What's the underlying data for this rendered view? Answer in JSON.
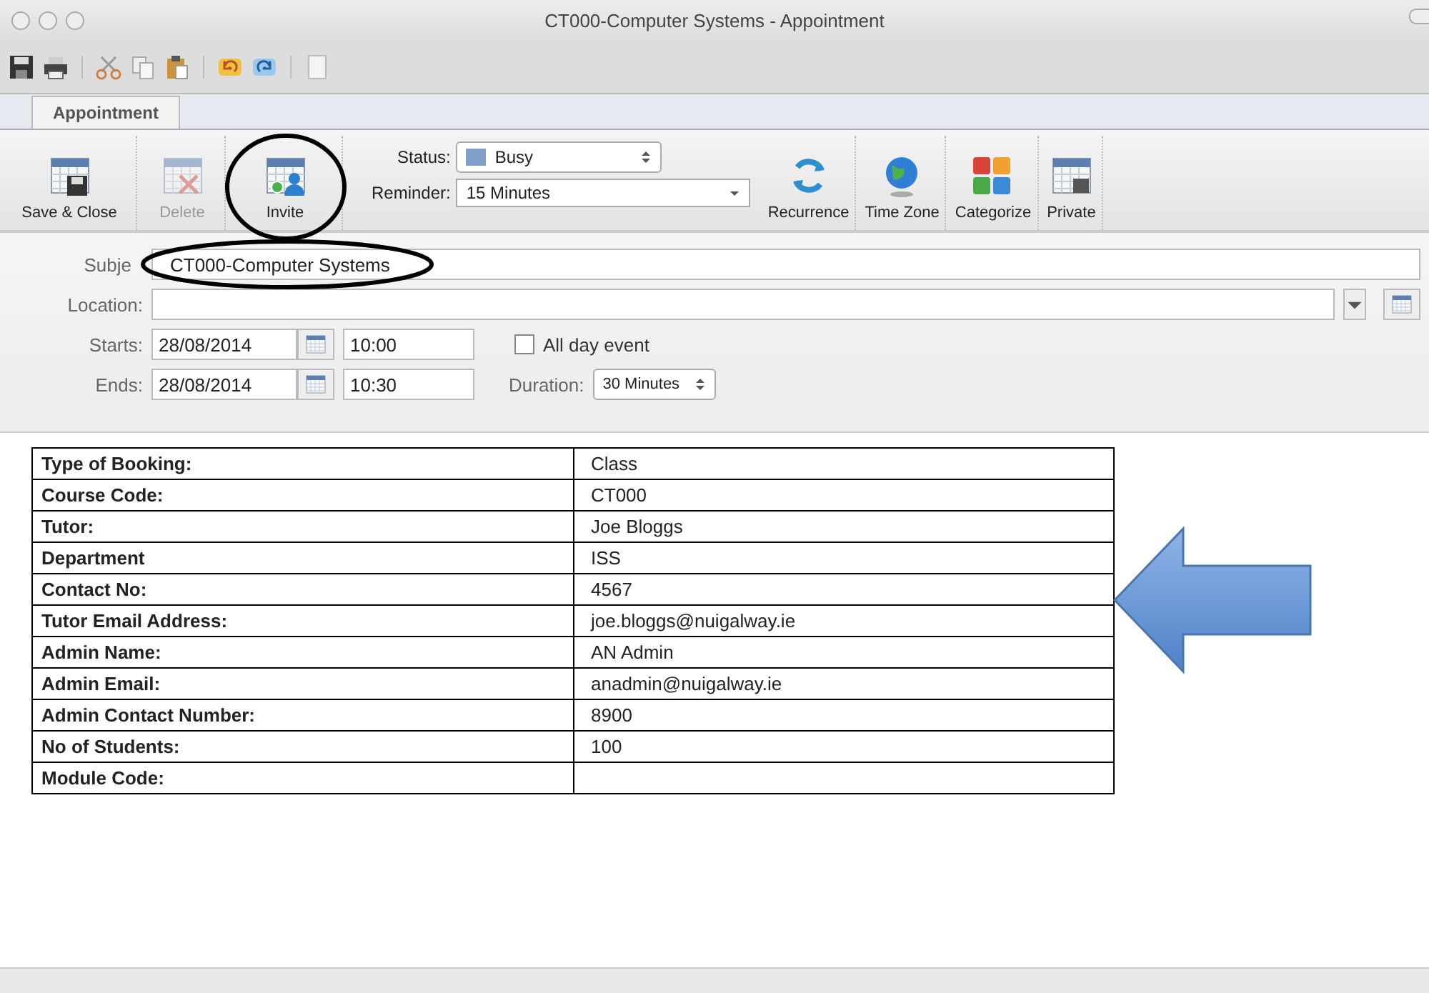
{
  "window": {
    "title": "CT000-Computer Systems - Appointment"
  },
  "tabs": [
    {
      "label": "Appointment",
      "selected": true
    }
  ],
  "ribbon": {
    "buttons": [
      {
        "label": "Save & Close",
        "disabled": false
      },
      {
        "label": "Delete",
        "disabled": true
      },
      {
        "label": "Invite",
        "disabled": false
      }
    ],
    "status": {
      "label": "Status:",
      "value": "Busy"
    },
    "reminder": {
      "label": "Reminder:",
      "value": "15 Minutes"
    },
    "buttons2": [
      {
        "label": "Recurrence",
        "disabled": false
      },
      {
        "label": "Time Zone",
        "disabled": false
      },
      {
        "label": "Categorize",
        "disabled": false
      },
      {
        "label": "Private",
        "disabled": false
      }
    ]
  },
  "form": {
    "subject": {
      "label": "Subje",
      "value": "CT000-Computer Systems"
    },
    "location": {
      "label": "Location:"
    },
    "starts": {
      "label": "Starts:",
      "date": "28/08/2014",
      "time": "10:00"
    },
    "all_day": {
      "label": "All day event",
      "checked": false
    },
    "ends": {
      "label": "Ends:",
      "date": "28/08/2014",
      "time": "10:30"
    },
    "duration": {
      "label": "Duration:",
      "value": "30 Minutes"
    }
  },
  "table": {
    "rows": [
      {
        "label": "Type of Booking:",
        "value": "Class"
      },
      {
        "label": "Course Code:",
        "value": "CT000"
      },
      {
        "label": "Tutor:",
        "value": "Joe Bloggs"
      },
      {
        "label": "Department",
        "value": "ISS"
      },
      {
        "label": "Contact No:",
        "value": "4567"
      },
      {
        "label": "Tutor Email Address:",
        "value": "joe.bloggs@nuigalway.ie"
      },
      {
        "label": "Admin Name:",
        "value": "AN Admin"
      },
      {
        "label": "Admin Email:",
        "value": "anadmin@nuigalway.ie"
      },
      {
        "label": "Admin Contact Number:",
        "value": "8900"
      },
      {
        "label": "No of Students:",
        "value": "100"
      },
      {
        "label": "Module Code:",
        "value": ""
      }
    ]
  }
}
